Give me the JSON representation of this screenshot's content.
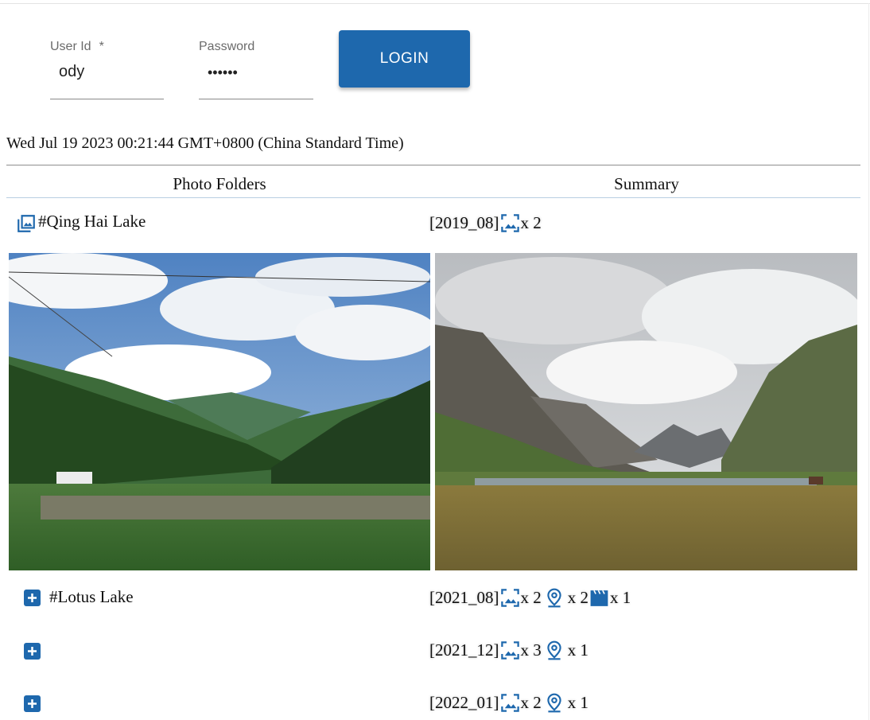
{
  "login": {
    "user_id_label": "User Id",
    "required_mark": "*",
    "user_id_value": "ody",
    "password_label": "Password",
    "password_value": "••••••",
    "button_label": "LOGIN"
  },
  "datetime": "Wed Jul 19 2023 00:21:44 GMT+0800 (China Standard Time)",
  "table": {
    "headers": [
      "Photo Folders",
      "Summary"
    ],
    "rows": [
      {
        "name": "#Qing Hai Lake",
        "summary": {
          "date": "[2019_08]",
          "photos": "x 2"
        }
      },
      {
        "name": "#Lotus Lake",
        "summary": {
          "date": "[2021_08]",
          "photos": "x 2",
          "locations": "x 2",
          "videos": "x 1"
        }
      },
      {
        "name": "",
        "summary": {
          "date": "[2021_12]",
          "photos": "x 3",
          "locations": "x 1"
        }
      },
      {
        "name": "",
        "summary": {
          "date": "[2022_01]",
          "photos": "x 2",
          "locations": "x 1"
        }
      }
    ]
  },
  "icons": {
    "folder": "photo-library-icon",
    "photo": "image-icon",
    "location": "location-pin-icon",
    "video": "movie-clapper-icon",
    "expand": "plus-box-icon"
  },
  "colors": {
    "accent": "#1e68ad"
  }
}
